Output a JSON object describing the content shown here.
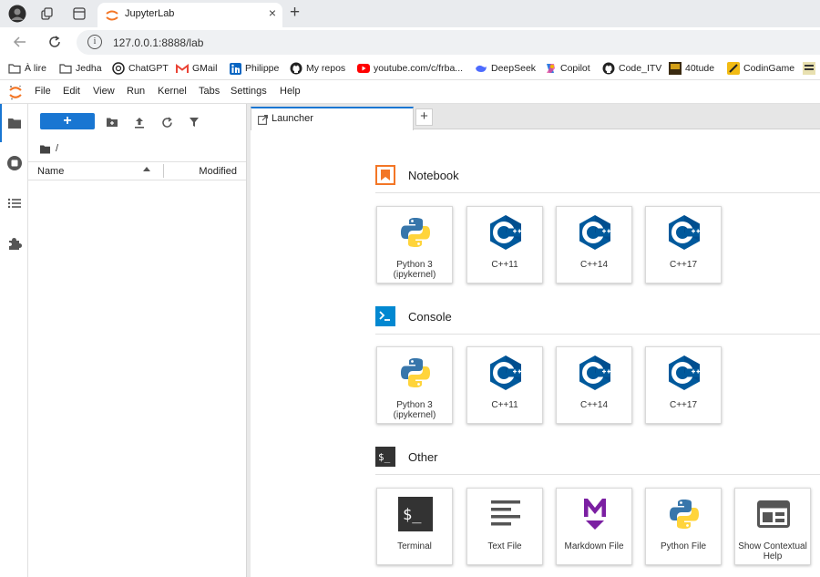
{
  "browser": {
    "tab_title": "JupyterLab",
    "tab_close": "×",
    "new_tab": "+",
    "url": "127.0.0.1:8888/lab",
    "info_glyph": "i",
    "bookmarks": [
      {
        "label": "À lire",
        "icon": "folder-icon"
      },
      {
        "label": "Jedha",
        "icon": "folder-icon"
      },
      {
        "label": "ChatGPT",
        "icon": "chatgpt-icon"
      },
      {
        "label": "GMail",
        "icon": "gmail-icon"
      },
      {
        "label": "Philippe",
        "icon": "linkedin-icon"
      },
      {
        "label": "My repos",
        "icon": "github-icon"
      },
      {
        "label": "youtube.com/c/frba...",
        "icon": "youtube-icon"
      },
      {
        "label": "DeepSeek",
        "icon": "deepseek-icon"
      },
      {
        "label": "Copilot",
        "icon": "copilot-icon"
      },
      {
        "label": "Code_ITV",
        "icon": "github-icon"
      },
      {
        "label": "40tude",
        "icon": "site-icon"
      },
      {
        "label": "CodinGame",
        "icon": "codingame-icon"
      }
    ]
  },
  "jupyter": {
    "menu": [
      "File",
      "Edit",
      "View",
      "Run",
      "Kernel",
      "Tabs",
      "Settings",
      "Help"
    ],
    "filebrowser": {
      "new_button": "+",
      "breadcrumb": "/",
      "col_name": "Name",
      "col_modified": "Modified"
    },
    "tab": {
      "label": "Launcher",
      "add": "+"
    },
    "sections": {
      "notebook": {
        "title": "Notebook",
        "items": [
          {
            "label": "Python 3 (ipykernel)",
            "icon": "python-icon"
          },
          {
            "label": "C++11",
            "icon": "cpp-icon"
          },
          {
            "label": "C++14",
            "icon": "cpp-icon"
          },
          {
            "label": "C++17",
            "icon": "cpp-icon"
          }
        ]
      },
      "console": {
        "title": "Console",
        "items": [
          {
            "label": "Python 3 (ipykernel)",
            "icon": "python-icon"
          },
          {
            "label": "C++11",
            "icon": "cpp-icon"
          },
          {
            "label": "C++14",
            "icon": "cpp-icon"
          },
          {
            "label": "C++17",
            "icon": "cpp-icon"
          }
        ]
      },
      "other": {
        "title": "Other",
        "items": [
          {
            "label": "Terminal",
            "icon": "terminal-icon"
          },
          {
            "label": "Text File",
            "icon": "text-file-icon"
          },
          {
            "label": "Markdown File",
            "icon": "markdown-icon"
          },
          {
            "label": "Python File",
            "icon": "python-icon"
          },
          {
            "label": "Show Contextual Help",
            "icon": "contextual-help-icon"
          }
        ]
      }
    }
  },
  "colors": {
    "accent": "#1976d2",
    "notebook_orange": "#f37626",
    "console_blue": "#0288d1",
    "cpp_blue": "#00599c",
    "markdown_purple": "#7b1fa2"
  }
}
